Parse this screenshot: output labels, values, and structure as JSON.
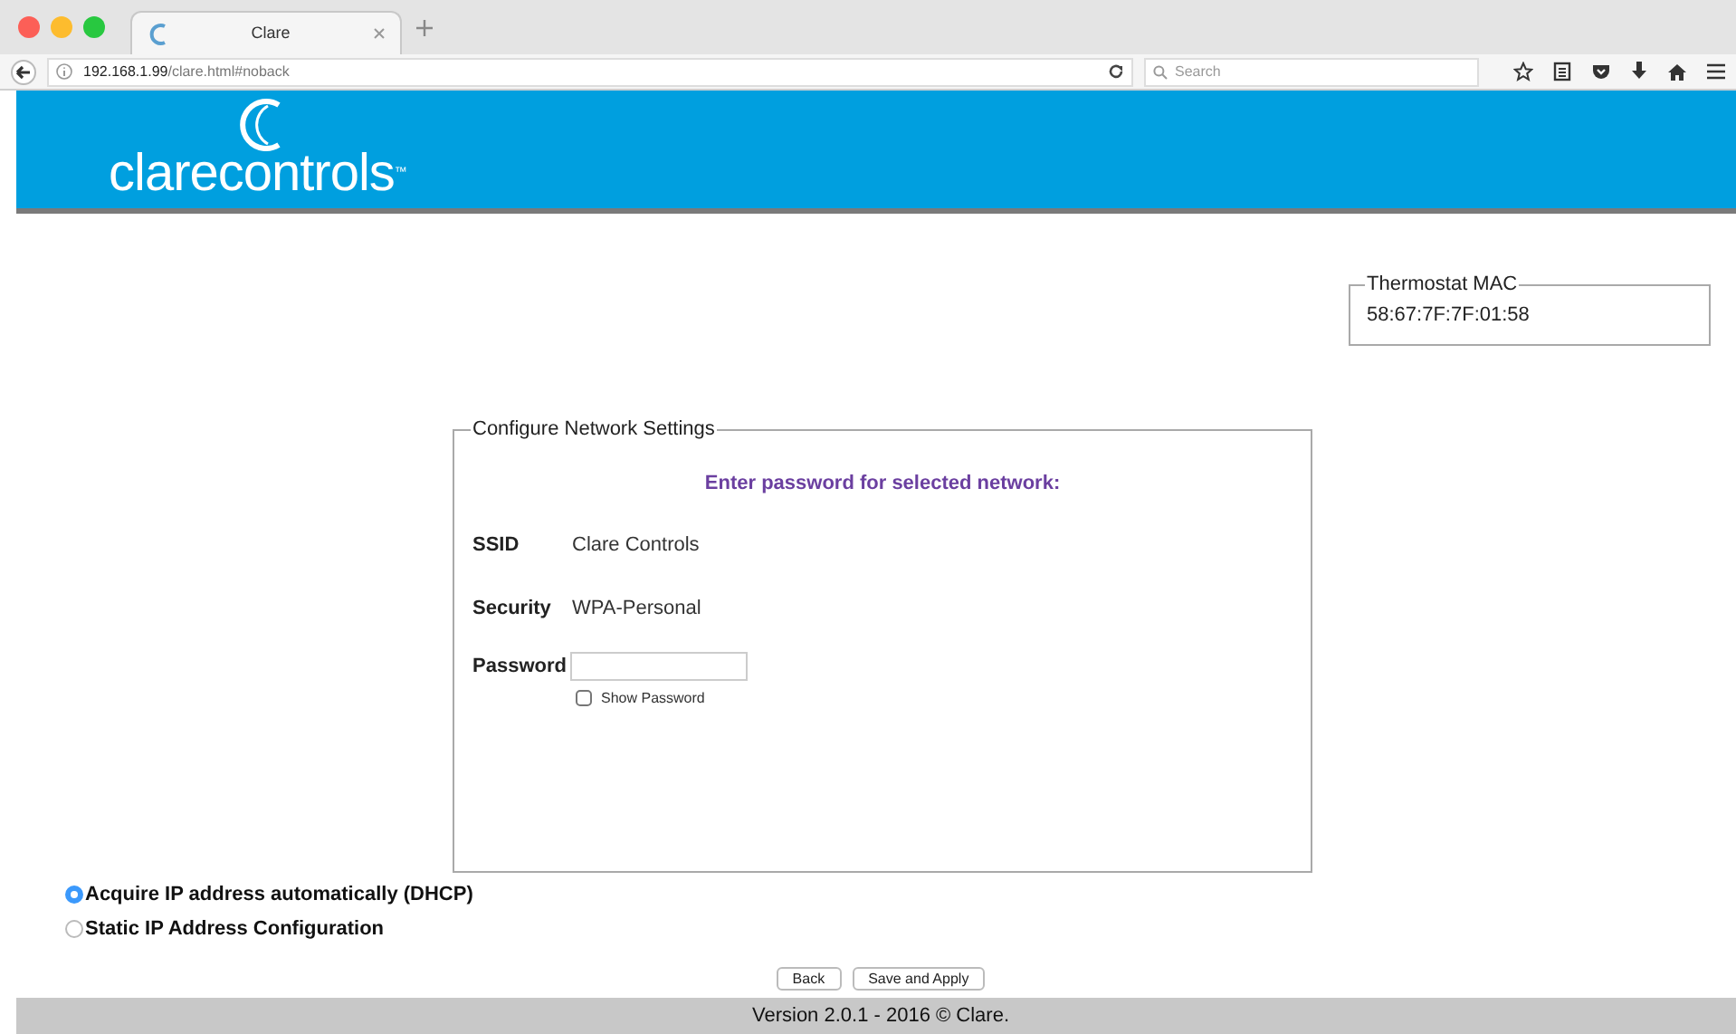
{
  "browser": {
    "tab_title": "Clare",
    "url_host": "192.168.1.99",
    "url_path": "/clare.html#noback",
    "search": {
      "placeholder": "Search"
    }
  },
  "logo": {
    "word_1": "clare",
    "word_2": "controls",
    "mark": "™"
  },
  "thermostat": {
    "legend": "Thermostat MAC",
    "value": "58:67:7F:7F:01:58"
  },
  "network": {
    "legend": "Configure Network Settings",
    "prompt": "Enter password for selected network:",
    "rows": [
      {
        "label": "SSID",
        "value": "Clare Controls"
      },
      {
        "label": "Security",
        "value": "WPA-Personal"
      }
    ],
    "password": {
      "label": "Password"
    },
    "show_password": {
      "label": "Show Password",
      "checked": false
    }
  },
  "ip_options": [
    {
      "label": "Acquire IP address automatically (DHCP)",
      "selected": true
    },
    {
      "label": "Static IP Address Configuration",
      "selected": false
    }
  ],
  "buttons": [
    "Back",
    "Save and Apply"
  ],
  "footer": "Version 2.0.1 - 2016 © Clare."
}
